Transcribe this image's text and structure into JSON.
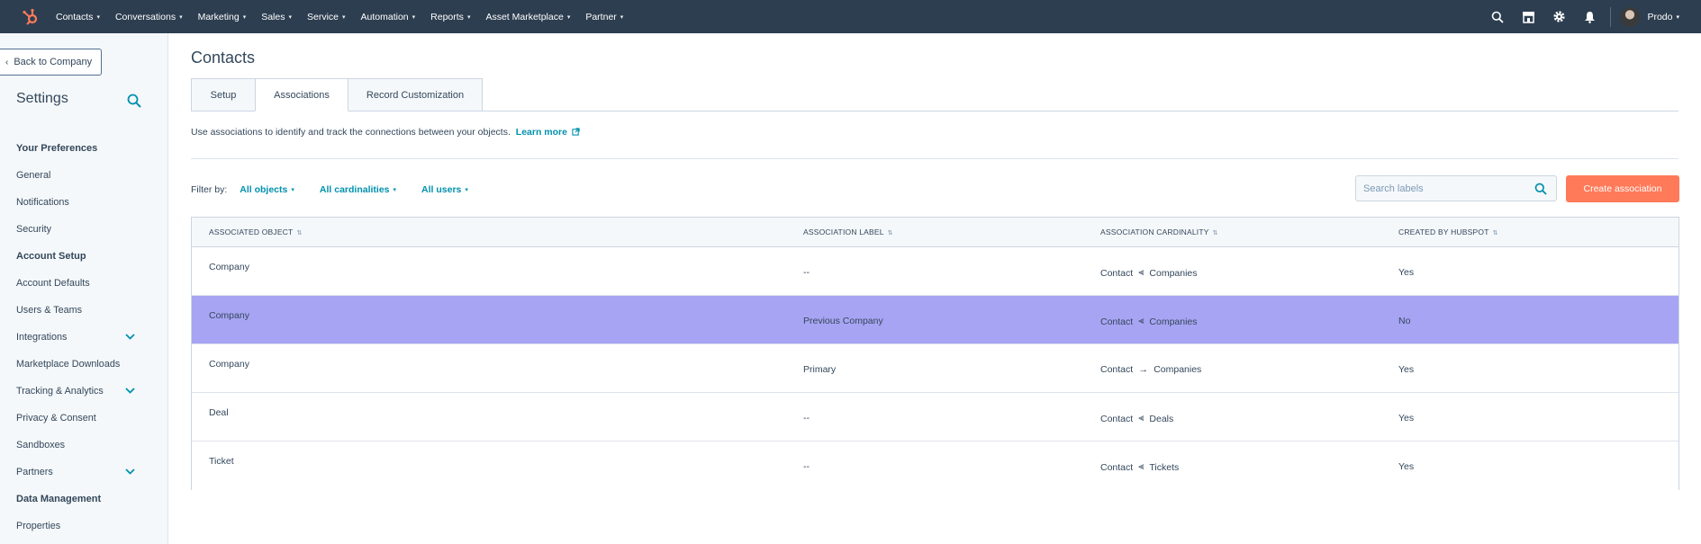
{
  "topnav": {
    "items": [
      {
        "label": "Contacts"
      },
      {
        "label": "Conversations"
      },
      {
        "label": "Marketing"
      },
      {
        "label": "Sales"
      },
      {
        "label": "Service"
      },
      {
        "label": "Automation"
      },
      {
        "label": "Reports"
      },
      {
        "label": "Asset Marketplace"
      },
      {
        "label": "Partner"
      }
    ],
    "user_name": "Prodo"
  },
  "sidebar": {
    "back_label": "Back to Company",
    "title": "Settings",
    "sections": [
      {
        "heading": "Your Preferences",
        "items": [
          "General",
          "Notifications",
          "Security"
        ]
      },
      {
        "heading": "Account Setup",
        "items": [
          "Account Defaults",
          "Users & Teams",
          "Integrations",
          "Marketplace Downloads",
          "Tracking & Analytics",
          "Privacy & Consent",
          "Sandboxes",
          "Partners"
        ]
      },
      {
        "heading": "Data Management",
        "items": [
          "Properties"
        ]
      }
    ]
  },
  "main": {
    "title": "Contacts",
    "tabs": [
      {
        "label": "Setup"
      },
      {
        "label": "Associations"
      },
      {
        "label": "Record Customization"
      }
    ],
    "description": "Use associations to identify and track the connections between your objects.",
    "learn_more": "Learn more",
    "filter": {
      "label": "Filter by:",
      "objects": "All objects",
      "cardinalities": "All cardinalities",
      "users": "All users"
    },
    "search_placeholder": "Search labels",
    "create_button": "Create association"
  },
  "table": {
    "headers": [
      "ASSOCIATED OBJECT",
      "ASSOCIATION LABEL",
      "ASSOCIATION CARDINALITY",
      "CREATED BY HUBSPOT"
    ],
    "rows": [
      {
        "object": "Company",
        "label": "--",
        "from": "Contact",
        "cardinality_icon": "one-to-many-icon",
        "to": "Companies",
        "hubspot": "Yes"
      },
      {
        "object": "Company",
        "label": "Previous Company",
        "from": "Contact",
        "cardinality_icon": "one-to-many-icon",
        "to": "Companies",
        "hubspot": "No"
      },
      {
        "object": "Company",
        "label": "Primary",
        "from": "Contact",
        "cardinality_icon": "one-to-one-arrow-icon",
        "to": "Companies",
        "hubspot": "Yes"
      },
      {
        "object": "Deal",
        "label": "--",
        "from": "Contact",
        "cardinality_icon": "one-to-many-icon",
        "to": "Deals",
        "hubspot": "Yes"
      },
      {
        "object": "Ticket",
        "label": "--",
        "from": "Contact",
        "cardinality_icon": "one-to-many-icon",
        "to": "Tickets",
        "hubspot": "Yes"
      }
    ]
  },
  "colors": {
    "nav_bg": "#2d3e50",
    "accent": "#0091ae",
    "cta": "#ff7a59",
    "selected_row": "#a7a4f3"
  }
}
